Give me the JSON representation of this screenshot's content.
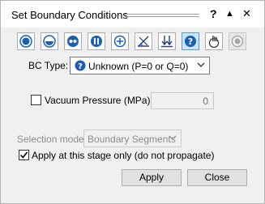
{
  "window": {
    "title": "Set Boundary Conditions",
    "help_label": "?",
    "collapse_label": "▲",
    "close_label": "✕"
  },
  "toolbar": {
    "buttons": [
      {
        "icon": "bc-fully-fixed-icon",
        "selected": false
      },
      {
        "icon": "bc-half-fixed-icon",
        "selected": false
      },
      {
        "icon": "bc-restrained-icon",
        "selected": false
      },
      {
        "icon": "bc-pin-icon",
        "selected": false
      },
      {
        "icon": "bc-crosshair-icon",
        "selected": false
      },
      {
        "icon": "bc-angle-icon",
        "selected": false
      },
      {
        "icon": "bc-arrows-down-icon",
        "selected": false
      },
      {
        "icon": "bc-unknown-icon",
        "selected": true
      },
      {
        "icon": "bc-hand-icon",
        "selected": false
      },
      {
        "icon": "bc-disabled-circle-icon",
        "selected": false,
        "disabled": true
      }
    ]
  },
  "bc_type": {
    "label": "BC Type:",
    "value": "Unknown (P=0 or Q=0)"
  },
  "vacuum": {
    "label": "Vacuum Pressure (MPa):",
    "checked": false,
    "value": "0"
  },
  "selection_mode": {
    "label": "Selection mode:",
    "value": "Boundary Segments"
  },
  "apply_stage": {
    "label": "Apply at this stage only (do not propagate)",
    "checked": true
  },
  "buttons": {
    "apply": "Apply",
    "close": "Close"
  },
  "colors": {
    "accent": "#1a5fb4",
    "selected_bg": "#cce4f7"
  }
}
